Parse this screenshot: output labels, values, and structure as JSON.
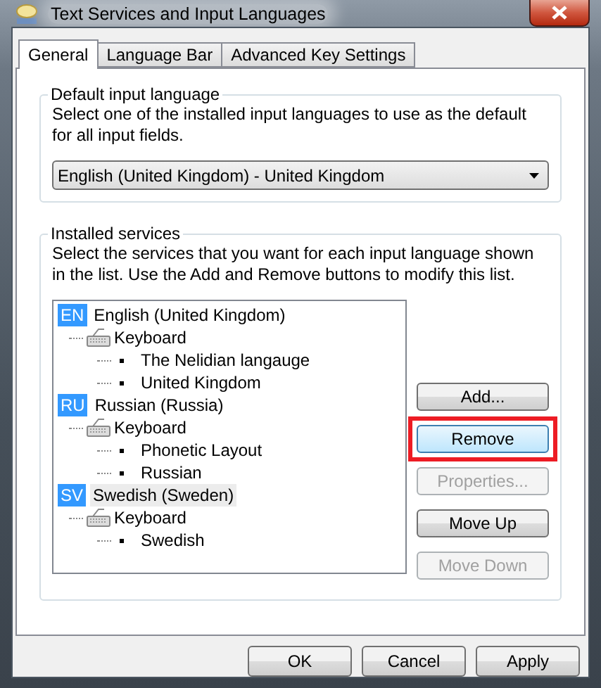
{
  "window": {
    "title": "Text Services and Input Languages"
  },
  "tabs": [
    {
      "label": "General",
      "selected": true
    },
    {
      "label": "Language Bar",
      "selected": false
    },
    {
      "label": "Advanced Key Settings",
      "selected": false
    }
  ],
  "default_language": {
    "legend": "Default input language",
    "description": "Select one of the installed input languages to use as the default for all input fields.",
    "value": "English (United Kingdom) - United Kingdom"
  },
  "installed_services": {
    "legend": "Installed services",
    "description": "Select the services that you want for each input language shown in the list. Use the Add and Remove buttons to modify this list.",
    "tree": [
      {
        "code": "EN",
        "label": "English (United Kingdom)",
        "selected": false,
        "children": [
          {
            "label": "Keyboard",
            "children": [
              {
                "label": "The Nelidian langauge"
              },
              {
                "label": "United Kingdom"
              }
            ]
          }
        ]
      },
      {
        "code": "RU",
        "label": "Russian (Russia)",
        "selected": false,
        "children": [
          {
            "label": "Keyboard",
            "children": [
              {
                "label": "Phonetic Layout"
              },
              {
                "label": "Russian"
              }
            ]
          }
        ]
      },
      {
        "code": "SV",
        "label": "Swedish (Sweden)",
        "selected": true,
        "children": [
          {
            "label": "Keyboard",
            "children": [
              {
                "label": "Swedish"
              }
            ]
          }
        ]
      }
    ],
    "buttons": [
      {
        "label": "Add...",
        "disabled": false,
        "highlighted": false
      },
      {
        "label": "Remove",
        "disabled": false,
        "highlighted": true
      },
      {
        "label": "Properties...",
        "disabled": true,
        "highlighted": false
      },
      {
        "label": "Move Up",
        "disabled": false,
        "highlighted": false
      },
      {
        "label": "Move Down",
        "disabled": true,
        "highlighted": false
      }
    ]
  },
  "footer_buttons": [
    {
      "label": "OK"
    },
    {
      "label": "Cancel"
    },
    {
      "label": "Apply"
    }
  ]
}
